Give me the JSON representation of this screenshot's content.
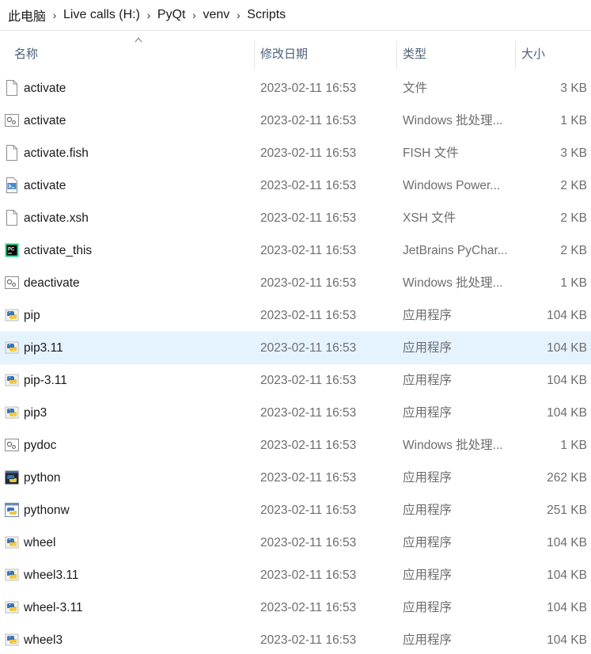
{
  "breadcrumb": {
    "items": [
      "此电脑",
      "Live calls (H:)",
      "PyQt",
      "venv",
      "Scripts"
    ],
    "separator": "›"
  },
  "columns": {
    "name": "名称",
    "date": "修改日期",
    "type": "类型",
    "size": "大小"
  },
  "colors": {
    "header_text": "#4c607a",
    "selected_row": "#e5f3ff",
    "secondary_text": "#6d6d6d"
  },
  "files": [
    {
      "name": "activate",
      "date": "2023-02-11 16:53",
      "type": "文件",
      "size": "3 KB",
      "icon": "generic-file-icon",
      "selected": false
    },
    {
      "name": "activate",
      "date": "2023-02-11 16:53",
      "type": "Windows 批处理...",
      "size": "1 KB",
      "icon": "batch-file-icon",
      "selected": false
    },
    {
      "name": "activate.fish",
      "date": "2023-02-11 16:53",
      "type": "FISH 文件",
      "size": "3 KB",
      "icon": "generic-file-icon",
      "selected": false
    },
    {
      "name": "activate",
      "date": "2023-02-11 16:53",
      "type": "Windows Power...",
      "size": "2 KB",
      "icon": "powershell-script-icon",
      "selected": false
    },
    {
      "name": "activate.xsh",
      "date": "2023-02-11 16:53",
      "type": "XSH 文件",
      "size": "2 KB",
      "icon": "generic-file-icon",
      "selected": false
    },
    {
      "name": "activate_this",
      "date": "2023-02-11 16:53",
      "type": "JetBrains PyChar...",
      "size": "2 KB",
      "icon": "pycharm-file-icon",
      "selected": false
    },
    {
      "name": "deactivate",
      "date": "2023-02-11 16:53",
      "type": "Windows 批处理...",
      "size": "1 KB",
      "icon": "batch-file-icon",
      "selected": false
    },
    {
      "name": "pip",
      "date": "2023-02-11 16:53",
      "type": "应用程序",
      "size": "104 KB",
      "icon": "python-exe-icon",
      "selected": false
    },
    {
      "name": "pip3.11",
      "date": "2023-02-11 16:53",
      "type": "应用程序",
      "size": "104 KB",
      "icon": "python-exe-icon",
      "selected": true
    },
    {
      "name": "pip-3.11",
      "date": "2023-02-11 16:53",
      "type": "应用程序",
      "size": "104 KB",
      "icon": "python-exe-icon",
      "selected": false
    },
    {
      "name": "pip3",
      "date": "2023-02-11 16:53",
      "type": "应用程序",
      "size": "104 KB",
      "icon": "python-exe-icon",
      "selected": false
    },
    {
      "name": "pydoc",
      "date": "2023-02-11 16:53",
      "type": "Windows 批处理...",
      "size": "1 KB",
      "icon": "batch-file-icon",
      "selected": false
    },
    {
      "name": "python",
      "date": "2023-02-11 16:53",
      "type": "应用程序",
      "size": "262 KB",
      "icon": "python-console-icon",
      "selected": false
    },
    {
      "name": "pythonw",
      "date": "2023-02-11 16:53",
      "type": "应用程序",
      "size": "251 KB",
      "icon": "pythonw-window-icon",
      "selected": false
    },
    {
      "name": "wheel",
      "date": "2023-02-11 16:53",
      "type": "应用程序",
      "size": "104 KB",
      "icon": "python-exe-icon",
      "selected": false
    },
    {
      "name": "wheel3.11",
      "date": "2023-02-11 16:53",
      "type": "应用程序",
      "size": "104 KB",
      "icon": "python-exe-icon",
      "selected": false
    },
    {
      "name": "wheel-3.11",
      "date": "2023-02-11 16:53",
      "type": "应用程序",
      "size": "104 KB",
      "icon": "python-exe-icon",
      "selected": false
    },
    {
      "name": "wheel3",
      "date": "2023-02-11 16:53",
      "type": "应用程序",
      "size": "104 KB",
      "icon": "python-exe-icon",
      "selected": false
    }
  ]
}
